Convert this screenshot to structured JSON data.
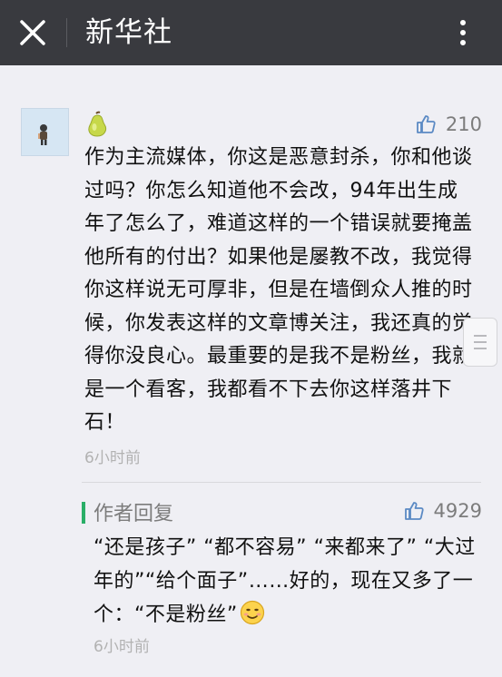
{
  "header": {
    "title": "新华社",
    "close_icon": "close-icon",
    "more_icon": "more-vertical-icon"
  },
  "comment": {
    "avatar_icon": "user-avatar",
    "emoji_icon": "pear-emoji",
    "likes": "210",
    "text": "作为主流媒体，你这是恶意封杀，你和他谈过吗？你怎么知道他不会改，94年出生成年了怎么了，难道这样的一个错误就要掩盖他所有的付出？如果他是屡教不改，我觉得你这样说无可厚非，但是在墙倒众人推的时候，你发表这样的文章博关注，我还真的觉得你没良心。最重要的是我不是粉丝，我就是一个看客，我都看不下去你这样落井下石！",
    "time": "6小时前"
  },
  "reply": {
    "label": "作者回复",
    "likes": "4929",
    "text": "“还是孩子” “都不容易” “来都来了” “大过年的”“给个面子”……好的，现在又多了一个：“不是粉丝”",
    "emoji_icon": "smiley-emoji",
    "time": "6小时前"
  },
  "colors": {
    "header_bg": "#393a3f",
    "page_bg": "#efeff4",
    "accent_green": "#2aae67",
    "like_blue": "#5b8ac4"
  }
}
